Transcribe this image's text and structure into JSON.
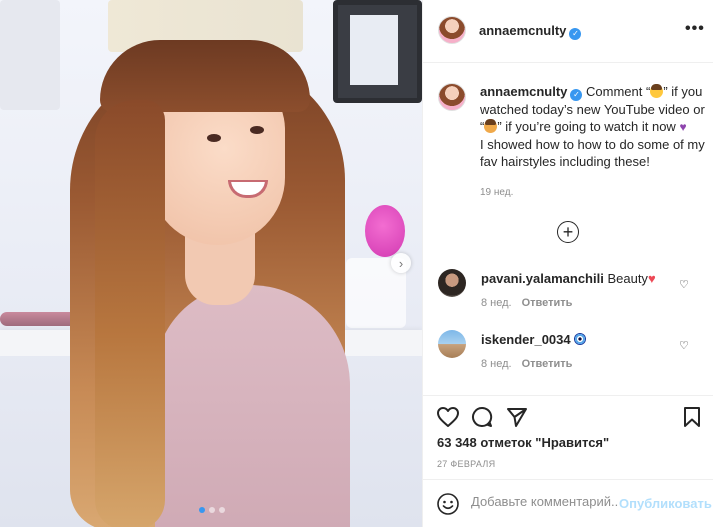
{
  "post": {
    "username": "annaemcnulty",
    "verified_mark": "✓",
    "more_label": "•••",
    "carousel": {
      "slide_count": 3,
      "active_slide": 1,
      "next_label": "›"
    }
  },
  "caption": {
    "username": "annaemcnulty",
    "text_1": " Comment “",
    "text_2": "” if you watched today’s new YouTube video or “",
    "text_3": "” if you’re going to watch it now ",
    "purple_heart": "♥",
    "text_4": "I showed how to how to do some of my fav hairstyles including these!",
    "time": "19 нед."
  },
  "load_more_label": "+",
  "comments": [
    {
      "username": "pavani.yalamanchili",
      "text": " Beauty",
      "emoji": "♥",
      "time": "8 нед.",
      "reply_label": "Ответить",
      "like_icon": "heart-outline-icon",
      "like_glyph": "♡"
    },
    {
      "username": "iskender_0034",
      "text": " ",
      "emoji": "evil-eye-icon",
      "time": "8 нед.",
      "reply_label": "Ответить",
      "like_icon": "heart-outline-icon",
      "like_glyph": "♡"
    }
  ],
  "actions": {
    "likes_text": "63 348 отметок \"Нравится\"",
    "date": "27 ФЕВРАЛЯ"
  },
  "comment_box": {
    "placeholder": "Добавьте комментарий...",
    "publish_label": "Опубликовать"
  },
  "colors": {
    "accent": "#3897f0",
    "muted": "#8e8e8e",
    "publish_disabled": "#b2dffc"
  }
}
